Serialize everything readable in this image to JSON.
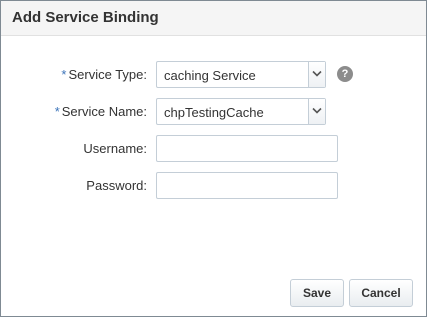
{
  "dialog": {
    "title": "Add Service Binding"
  },
  "form": {
    "service_type": {
      "label": "Service Type:",
      "required_marker": "*",
      "value": "caching Service"
    },
    "service_name": {
      "label": "Service Name:",
      "required_marker": "*",
      "value": "chpTestingCache"
    },
    "username": {
      "label": "Username:",
      "value": ""
    },
    "password": {
      "label": "Password:",
      "value": ""
    },
    "help_icon_glyph": "?"
  },
  "buttons": {
    "save_label": "Save",
    "cancel_label": "Cancel"
  },
  "colors": {
    "required_marker": "#3b73b9",
    "border": "#c4ced7",
    "header_bg": "#f5f5f5"
  },
  "icons": {
    "help": "question-circle-icon",
    "dropdown": "chevron-down-icon"
  }
}
